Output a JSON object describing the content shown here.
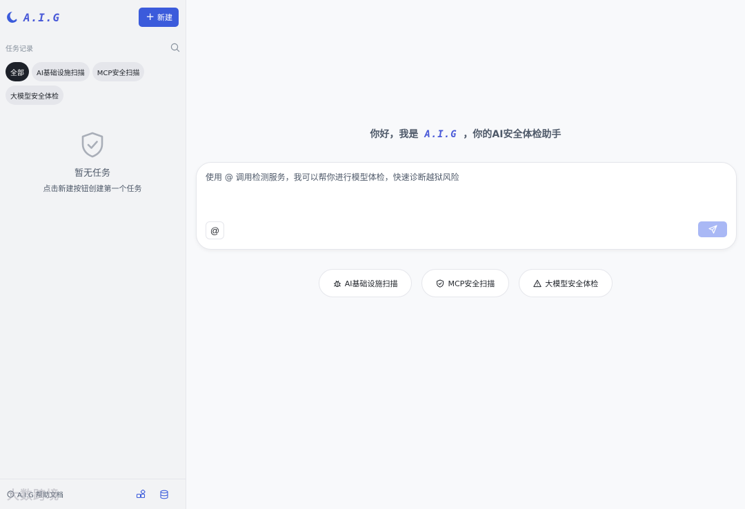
{
  "app": {
    "logo_text": "A.I.G",
    "accent": "#3b5bdb",
    "logo_icon": "crescent-logo-icon"
  },
  "sidebar": {
    "new_button": {
      "icon": "plus-icon",
      "label": "新建"
    },
    "section_title": "任务记录",
    "search_icon": "search-icon",
    "filters": [
      "全部",
      "AI基础设施扫描",
      "MCP安全扫描",
      "大模型安全体检"
    ],
    "active_filter": "全部",
    "empty_state": {
      "icon": "shield-check-icon",
      "title": "暂无任务",
      "subtitle": "点击新建按钮创建第一个任务"
    },
    "footer": {
      "help_label": "A.I.G 帮助文档",
      "icons": [
        "plugins-icon",
        "database-icon"
      ]
    },
    "watermark": "大数跨境"
  },
  "main": {
    "greeting_prefix": "你好，我是",
    "greeting_brand": "A.I.G",
    "greeting_suffix": "，你的AI安全体检助手",
    "composer": {
      "placeholder": "使用 @ 调用检测服务，我可以帮你进行模型体检，快速诊断越狱风险",
      "at_label": "@",
      "send_icon": "send-icon"
    },
    "quick_actions": [
      {
        "icon": "bug-icon",
        "label": "AI基础设施扫描"
      },
      {
        "icon": "shield-icon",
        "label": "MCP安全扫描"
      },
      {
        "icon": "warning-icon",
        "label": "大模型安全体检"
      }
    ]
  }
}
